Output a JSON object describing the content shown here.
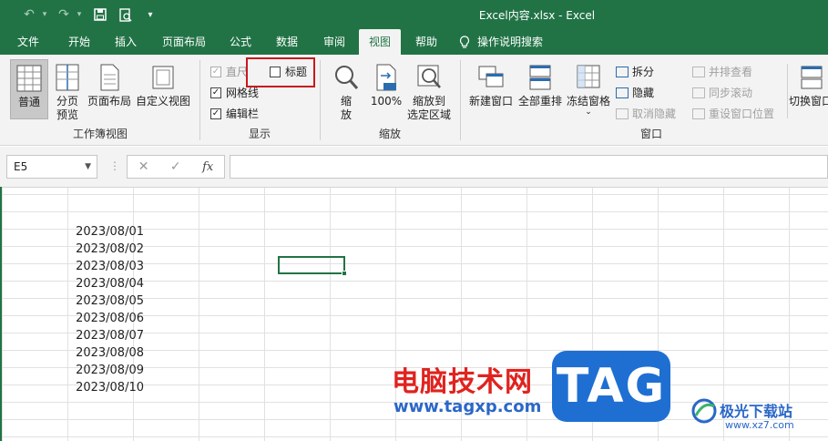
{
  "titlebar": {
    "title": "Excel内容.xlsx  -  Excel"
  },
  "menu": {
    "tabs": [
      "文件",
      "开始",
      "插入",
      "页面布局",
      "公式",
      "数据",
      "审阅",
      "视图",
      "帮助"
    ],
    "active": "视图",
    "search_label": "操作说明搜索"
  },
  "ribbon": {
    "workbook_views": {
      "normal": "普通",
      "page_break_1": "分页",
      "page_break_2": "预览",
      "page_layout": "页面布局",
      "custom_views": "自定义视图",
      "group_label": "工作簿视图"
    },
    "show": {
      "ruler": "直尺",
      "gridlines": "网格线",
      "formula_bar": "编辑栏",
      "headings": "标题",
      "group_label": "显示"
    },
    "zoom": {
      "zoom_1": "缩",
      "zoom_2": "放",
      "hundred": "100%",
      "to_selection_1": "缩放到",
      "to_selection_2": "选定区域",
      "group_label": "缩放"
    },
    "window": {
      "new_window": "新建窗口",
      "arrange_all": "全部重排",
      "freeze_panes": "冻结窗格",
      "split": "拆分",
      "hide": "隐藏",
      "unhide": "取消隐藏",
      "side_by_side": "并排查看",
      "sync_scroll": "同步滚动",
      "reset_position": "重设窗口位置",
      "switch_windows": "切换窗口",
      "group_label": "窗口"
    }
  },
  "formula_bar": {
    "name_box": "E5",
    "fx": "fx",
    "cancel": "✕",
    "enter": "✓",
    "value": ""
  },
  "sheet": {
    "dates": [
      "2023/08/01",
      "2023/08/02",
      "2023/08/03",
      "2023/08/04",
      "2023/08/05",
      "2023/08/06",
      "2023/08/07",
      "2023/08/08",
      "2023/08/09",
      "2023/08/10"
    ]
  },
  "watermark": {
    "title": "电脑技术网",
    "url": "www.tagxp.com",
    "tag": "TAG",
    "site": "极光下载站",
    "site_url": "www.xz7.com"
  },
  "colors": {
    "excel_green": "#217346",
    "highlight_red": "#c8191e"
  }
}
